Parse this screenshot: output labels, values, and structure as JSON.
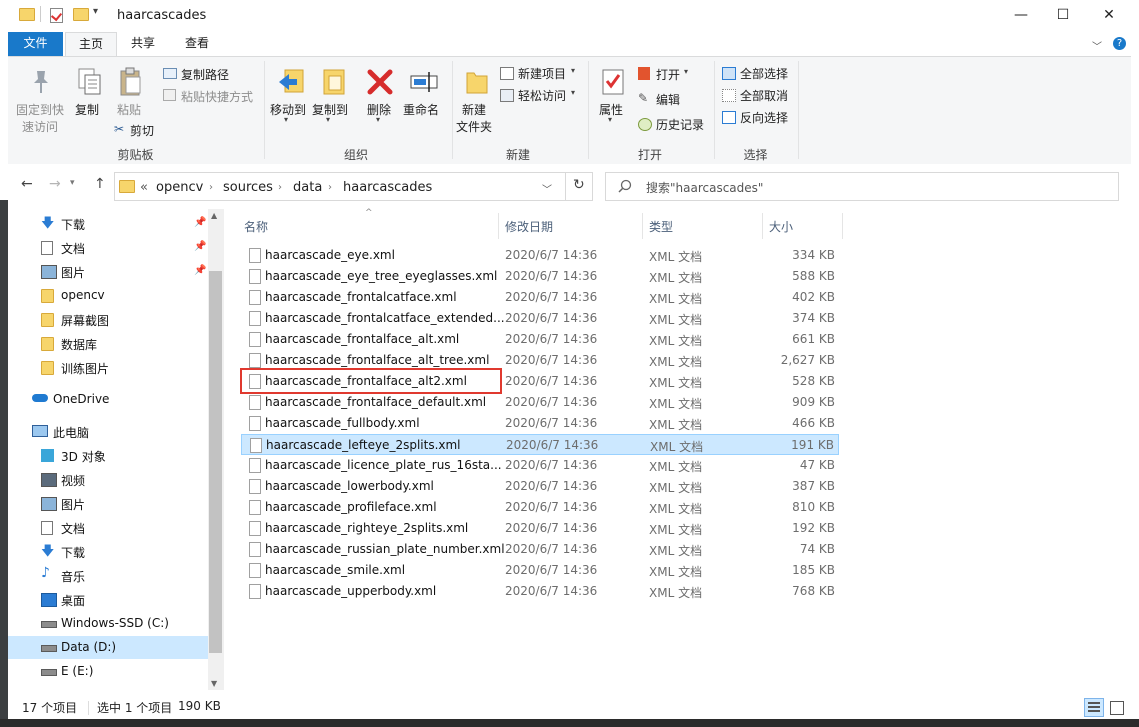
{
  "window": {
    "title": "haarcascades"
  },
  "tabs": [
    "文件",
    "主页",
    "共享",
    "查看"
  ],
  "ribbon": {
    "clipboard": {
      "pin_label": [
        "固定到快",
        "速访问"
      ],
      "copy_label": "复制",
      "paste_label": "粘贴",
      "copy_path_label": "复制路径",
      "paste_shortcut_label": "粘贴快捷方式",
      "cut_label": "剪切",
      "group_label": "剪贴板"
    },
    "organize": {
      "move_to_label": "移动到",
      "copy_to_label": "复制到",
      "delete_label": "删除",
      "rename_label": "重命名",
      "group_label": "组织"
    },
    "new": {
      "new_folder_label": [
        "新建",
        "文件夹"
      ],
      "new_item_label": "新建项目",
      "easy_access_label": "轻松访问",
      "group_label": "新建"
    },
    "open": {
      "properties_label": "属性",
      "open_label": "打开",
      "edit_label": "编辑",
      "history_label": "历史记录",
      "group_label": "打开"
    },
    "select": {
      "select_all_label": "全部选择",
      "select_none_label": "全部取消",
      "invert_label": "反向选择",
      "group_label": "选择"
    }
  },
  "address": {
    "overflow": "«",
    "crumbs": [
      "opencv",
      "sources",
      "data",
      "haarcascades"
    ],
    "search_placeholder": "搜索\"haarcascades\""
  },
  "nav": {
    "items": [
      {
        "label": "下载",
        "icon": "download-icon",
        "pinned": true
      },
      {
        "label": "文档",
        "icon": "document-icon",
        "pinned": true
      },
      {
        "label": "图片",
        "icon": "picture-icon",
        "pinned": true
      },
      {
        "label": "opencv",
        "icon": "folder-icon"
      },
      {
        "label": "屏幕截图",
        "icon": "folder-icon"
      },
      {
        "label": "数据库",
        "icon": "folder-icon"
      },
      {
        "label": "训练图片",
        "icon": "folder-icon"
      },
      {
        "label": "OneDrive",
        "icon": "cloud-icon"
      },
      {
        "label": "此电脑",
        "icon": "computer-icon"
      },
      {
        "label": "3D 对象",
        "icon": "cube-icon"
      },
      {
        "label": "视频",
        "icon": "video-icon"
      },
      {
        "label": "图片",
        "icon": "picture-icon"
      },
      {
        "label": "文档",
        "icon": "document-icon"
      },
      {
        "label": "下载",
        "icon": "download-icon"
      },
      {
        "label": "音乐",
        "icon": "music-icon"
      },
      {
        "label": "桌面",
        "icon": "desktop-icon"
      },
      {
        "label": "Windows-SSD (C:)",
        "icon": "drive-icon"
      },
      {
        "label": "Data (D:)",
        "icon": "drive-icon"
      },
      {
        "label": "E (E:)",
        "icon": "drive-icon"
      }
    ]
  },
  "list": {
    "columns": [
      "名称",
      "修改日期",
      "类型",
      "大小"
    ],
    "files": [
      {
        "name": "haarcascade_eye.xml",
        "date": "2020/6/7 14:36",
        "type": "XML 文档",
        "size": "334 KB"
      },
      {
        "name": "haarcascade_eye_tree_eyeglasses.xml",
        "date": "2020/6/7 14:36",
        "type": "XML 文档",
        "size": "588 KB"
      },
      {
        "name": "haarcascade_frontalcatface.xml",
        "date": "2020/6/7 14:36",
        "type": "XML 文档",
        "size": "402 KB"
      },
      {
        "name": "haarcascade_frontalcatface_extended...",
        "date": "2020/6/7 14:36",
        "type": "XML 文档",
        "size": "374 KB"
      },
      {
        "name": "haarcascade_frontalface_alt.xml",
        "date": "2020/6/7 14:36",
        "type": "XML 文档",
        "size": "661 KB"
      },
      {
        "name": "haarcascade_frontalface_alt_tree.xml",
        "date": "2020/6/7 14:36",
        "type": "XML 文档",
        "size": "2,627 KB"
      },
      {
        "name": "haarcascade_frontalface_alt2.xml",
        "date": "2020/6/7 14:36",
        "type": "XML 文档",
        "size": "528 KB"
      },
      {
        "name": "haarcascade_frontalface_default.xml",
        "date": "2020/6/7 14:36",
        "type": "XML 文档",
        "size": "909 KB"
      },
      {
        "name": "haarcascade_fullbody.xml",
        "date": "2020/6/7 14:36",
        "type": "XML 文档",
        "size": "466 KB"
      },
      {
        "name": "haarcascade_lefteye_2splits.xml",
        "date": "2020/6/7 14:36",
        "type": "XML 文档",
        "size": "191 KB"
      },
      {
        "name": "haarcascade_licence_plate_rus_16sta...",
        "date": "2020/6/7 14:36",
        "type": "XML 文档",
        "size": "47 KB"
      },
      {
        "name": "haarcascade_lowerbody.xml",
        "date": "2020/6/7 14:36",
        "type": "XML 文档",
        "size": "387 KB"
      },
      {
        "name": "haarcascade_profileface.xml",
        "date": "2020/6/7 14:36",
        "type": "XML 文档",
        "size": "810 KB"
      },
      {
        "name": "haarcascade_righteye_2splits.xml",
        "date": "2020/6/7 14:36",
        "type": "XML 文档",
        "size": "192 KB"
      },
      {
        "name": "haarcascade_russian_plate_number.xml",
        "date": "2020/6/7 14:36",
        "type": "XML 文档",
        "size": "74 KB"
      },
      {
        "name": "haarcascade_smile.xml",
        "date": "2020/6/7 14:36",
        "type": "XML 文档",
        "size": "185 KB"
      },
      {
        "name": "haarcascade_upperbody.xml",
        "date": "2020/6/7 14:36",
        "type": "XML 文档",
        "size": "768 KB"
      }
    ]
  },
  "status": {
    "item_count": "17 个项目",
    "selection": "选中 1 个项目",
    "selection_size": "190 KB"
  },
  "colors": {
    "accent": "#1979ca",
    "selection": "#cce8ff",
    "highlight_box": "#e0392f"
  }
}
